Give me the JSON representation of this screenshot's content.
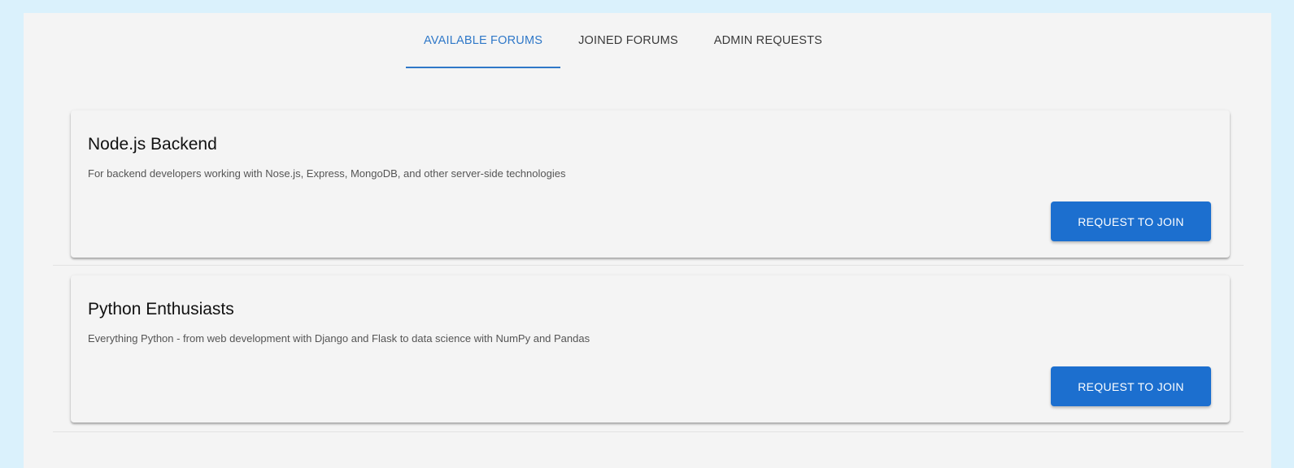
{
  "tabs": [
    {
      "label": "AVAILABLE FORUMS",
      "active": true
    },
    {
      "label": "JOINED FORUMS",
      "active": false
    },
    {
      "label": "ADMIN REQUESTS",
      "active": false
    }
  ],
  "forums": [
    {
      "title": "Node.js Backend",
      "description": "For backend developers working with Nose.js, Express, MongoDB, and other server-side technologies",
      "action_label": "REQUEST TO JOIN"
    },
    {
      "title": "Python Enthusiasts",
      "description": "Everything Python - from web development with Django and Flask to data science with NumPy and Pandas",
      "action_label": "REQUEST TO JOIN"
    }
  ],
  "colors": {
    "accent": "#2f78c8",
    "button": "#1c6fcf",
    "page_background": "#daf1fc",
    "panel_background": "#f4f4f4"
  }
}
